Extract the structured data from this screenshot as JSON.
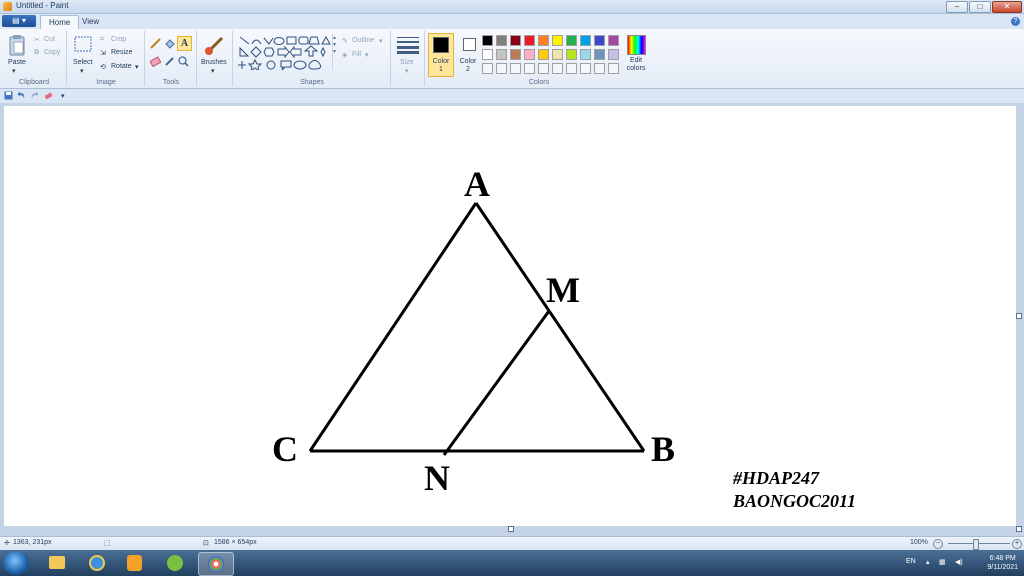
{
  "window": {
    "title": "Untitled - Paint"
  },
  "tabs": [
    {
      "label": "Home"
    },
    {
      "label": "View"
    }
  ],
  "ribbon": {
    "clipboard": {
      "paste": "Paste",
      "cut": "Cut",
      "copy": "Copy",
      "label": "Clipboard"
    },
    "image": {
      "select": "Select",
      "crop": "Crop",
      "resize": "Resize",
      "rotate": "Rotate",
      "label": "Image"
    },
    "tools": {
      "label": "Tools"
    },
    "brushes": {
      "label": "Brushes"
    },
    "shapes": {
      "outline": "Outline",
      "fill": "Fill",
      "label": "Shapes"
    },
    "size": {
      "label": "Size"
    },
    "colors": {
      "color1": "Color 1",
      "color2": "Color 2",
      "edit": "Edit colors",
      "label": "Colors",
      "color1_value": "#000000",
      "color2_value": "#ffffff",
      "palette_row1": [
        "#000000",
        "#7f7f7f",
        "#880015",
        "#ed1c24",
        "#ff7f27",
        "#fff200",
        "#22b14c",
        "#00a2e8",
        "#3f48cc",
        "#a349a4"
      ],
      "palette_row2": [
        "#ffffff",
        "#c3c3c3",
        "#b97a57",
        "#ffaec9",
        "#ffc90e",
        "#efe4b0",
        "#b5e61d",
        "#99d9ea",
        "#7092be",
        "#c8bfe7"
      ]
    }
  },
  "canvas": {
    "labels": {
      "a": "A",
      "m": "M",
      "c": "C",
      "b": "B",
      "n": "N"
    },
    "watermark": {
      "line1": "#HDAP247",
      "line2": "BAONGOC2011"
    }
  },
  "status": {
    "cursor": "1363, 231px",
    "size": "1586 × 654px",
    "zoom": "100%"
  },
  "taskbar": {
    "lang": "EN",
    "time": "6:48 PM",
    "date": "9/11/2021"
  }
}
